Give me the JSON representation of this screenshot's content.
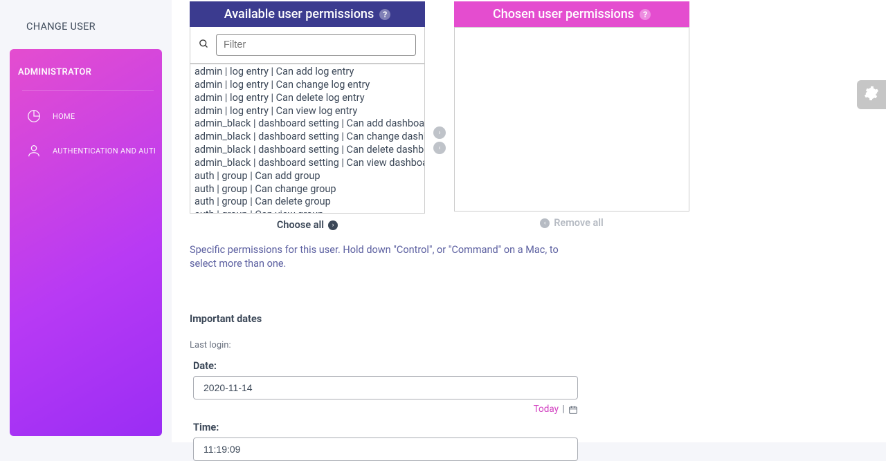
{
  "topTitle": "CHANGE USER",
  "sidebar": {
    "heading": "ADMINISTRATOR",
    "items": [
      {
        "label": "HOME"
      },
      {
        "label": "AUTHENTICATION AND AUTHORIZATION"
      }
    ]
  },
  "permissions": {
    "available": {
      "header": "Available user permissions",
      "filterPlaceholder": "Filter",
      "items": [
        "admin | log entry | Can add log entry",
        "admin | log entry | Can change log entry",
        "admin | log entry | Can delete log entry",
        "admin | log entry | Can view log entry",
        "admin_black | dashboard setting | Can add dashboard setting",
        "admin_black | dashboard setting | Can change dashboard setting",
        "admin_black | dashboard setting | Can delete dashboard setting",
        "admin_black | dashboard setting | Can view dashboard setting",
        "auth | group | Can add group",
        "auth | group | Can change group",
        "auth | group | Can delete group",
        "auth | group | Can view group"
      ],
      "chooseAll": "Choose all"
    },
    "chosen": {
      "header": "Chosen user permissions",
      "removeAll": "Remove all"
    },
    "helpText": "Specific permissions for this user. Hold down \"Control\", or \"Command\" on a Mac, to select more than one."
  },
  "dates": {
    "sectionTitle": "Important dates",
    "lastLoginLabel": "Last login:",
    "dateLabel": "Date:",
    "dateValue": "2020-11-14",
    "todayLink": "Today",
    "timeLabel": "Time:",
    "timeValue": "11:19:09"
  }
}
